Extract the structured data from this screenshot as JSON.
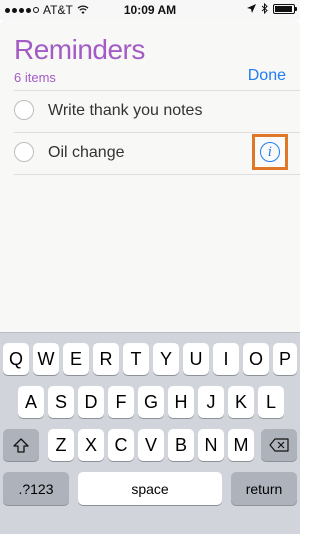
{
  "status_bar": {
    "carrier": "AT&T",
    "time": "10:09 AM"
  },
  "reminders": {
    "title": "Reminders",
    "count": "6 items",
    "done_label": "Done",
    "items": [
      {
        "text": "Write thank you notes"
      },
      {
        "text": "Oil change"
      }
    ]
  },
  "keyboard": {
    "row1": [
      "Q",
      "W",
      "E",
      "R",
      "T",
      "Y",
      "U",
      "I",
      "O",
      "P"
    ],
    "row2": [
      "A",
      "S",
      "D",
      "F",
      "G",
      "H",
      "J",
      "K",
      "L"
    ],
    "row3": [
      "Z",
      "X",
      "C",
      "V",
      "B",
      "N",
      "M"
    ],
    "numbers_label": ".?123",
    "space_label": "space",
    "return_label": "return"
  },
  "colors": {
    "accent_purple": "#a35cc6",
    "link_blue": "#1f7ef5",
    "highlight_orange": "#e0782a"
  }
}
